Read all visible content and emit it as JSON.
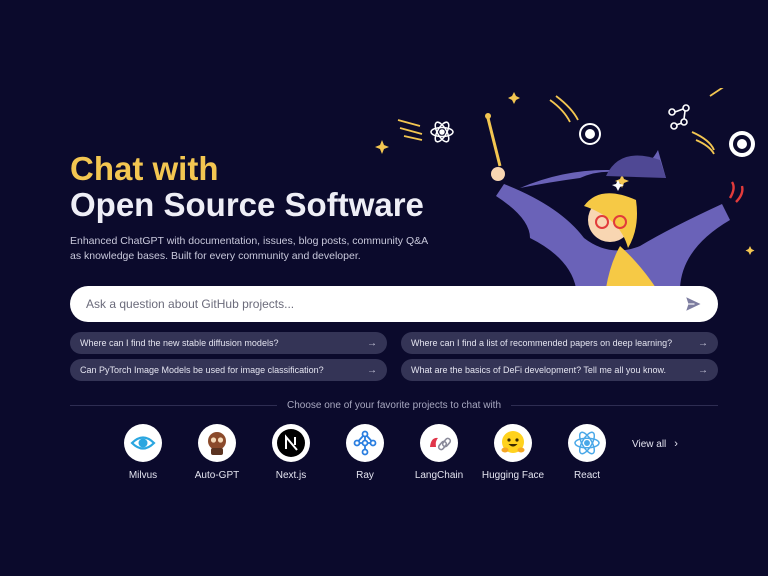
{
  "hero": {
    "title_line1": "Chat with",
    "title_line2": "Open Source Software",
    "subtitle": "Enhanced ChatGPT with documentation, issues, blog posts, community Q&A as knowledge bases. Built for every community and developer."
  },
  "search": {
    "placeholder": "Ask a question about GitHub projects...",
    "value": ""
  },
  "suggestions": [
    {
      "label": "Where can I find the new stable diffusion models?",
      "arrow": "→"
    },
    {
      "label": "Where can I find a list of recommended papers on deep learning?",
      "arrow": "→"
    },
    {
      "label": "Can PyTorch Image Models be used for image classification?",
      "arrow": "→"
    },
    {
      "label": "What are the basics of DeFi development? Tell me all you know.",
      "arrow": "→"
    }
  ],
  "projects_heading": "Choose one of your favorite projects to chat with",
  "projects": [
    {
      "name": "Milvus",
      "icon": "milvus-eye-icon"
    },
    {
      "name": "Auto-GPT",
      "icon": "auto-gpt-robot-icon"
    },
    {
      "name": "Next.js",
      "icon": "nextjs-n-icon"
    },
    {
      "name": "Ray",
      "icon": "ray-graph-icon"
    },
    {
      "name": "LangChain",
      "icon": "langchain-parrot-icon"
    },
    {
      "name": "Hugging Face",
      "icon": "hugging-face-emoji-icon"
    },
    {
      "name": "React",
      "icon": "react-atom-icon"
    }
  ],
  "view_all": {
    "label": "View all",
    "chevron": "›"
  },
  "colors": {
    "background": "#0b0a2c",
    "title_accent": "#f3c651",
    "chip_bg": "#343456",
    "wizard_purple": "#6a62b8",
    "hair_yellow": "#f6c945"
  }
}
